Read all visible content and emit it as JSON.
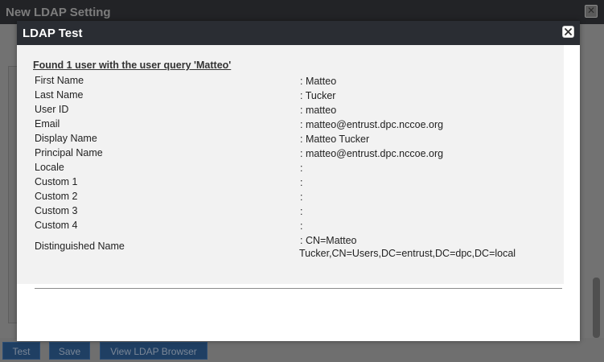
{
  "background_window": {
    "title": "New LDAP Setting",
    "buttons": {
      "test": "Test",
      "save": "Save",
      "browser": "View LDAP Browser"
    }
  },
  "dialog": {
    "title": "LDAP Test",
    "result_heading": "Found 1 user with the user query 'Matteo'",
    "fields": [
      {
        "label": "First Name",
        "value": ": Matteo"
      },
      {
        "label": "Last Name",
        "value": ": Tucker"
      },
      {
        "label": "User ID",
        "value": ": matteo"
      },
      {
        "label": "Email",
        "value": ": matteo@entrust.dpc.nccoe.org"
      },
      {
        "label": "Display Name",
        "value": ": Matteo Tucker"
      },
      {
        "label": "Principal Name",
        "value": ": matteo@entrust.dpc.nccoe.org"
      },
      {
        "label": "Locale",
        "value": ":"
      },
      {
        "label": "Custom 1",
        "value": ":"
      },
      {
        "label": "Custom 2",
        "value": ":"
      },
      {
        "label": "Custom 3",
        "value": ":"
      },
      {
        "label": "Custom 4",
        "value": ":"
      }
    ],
    "distinguished_name": {
      "label": "Distinguished Name",
      "value_line1": ": CN=Matteo",
      "value_line2": "Tucker,CN=Users,DC=entrust,DC=dpc,DC=local"
    }
  }
}
